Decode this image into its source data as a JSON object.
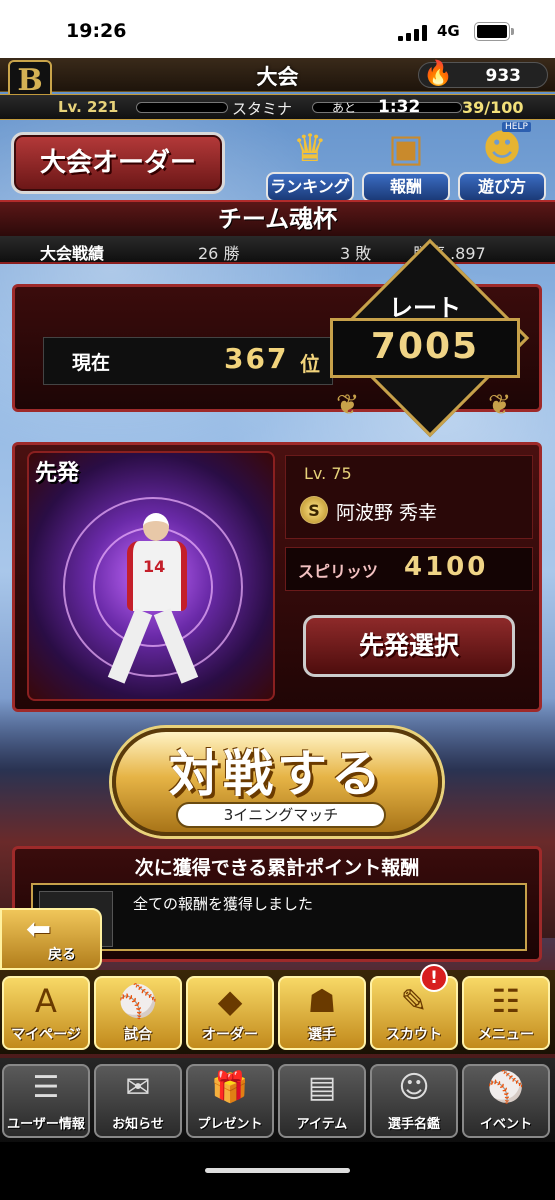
{
  "status_bar": {
    "time": "19:26",
    "network": "4G"
  },
  "header": {
    "logo": "B",
    "title": "大会",
    "coins": "933"
  },
  "level_bar": {
    "level": "Lv. 221",
    "stamina_label": "スタミナ",
    "remaining_label": "あと",
    "remaining_time": "1:32",
    "stamina": "39/100"
  },
  "top_buttons": {
    "order": "大会オーダー",
    "ranking": "ランキング",
    "rewards": "報酬",
    "how_to_play": "遊び方",
    "help": "HELP"
  },
  "tournament": {
    "name": "チーム魂杯",
    "record_label": "大会戦績",
    "wins": "26 勝",
    "losses": "3 敗",
    "win_rate": "勝率 .897"
  },
  "ranking": {
    "current_label": "現在",
    "position": "367",
    "position_suffix": "位",
    "rate_label": "レート",
    "rate_value": "7005"
  },
  "starter": {
    "label": "先発",
    "level": "Lv. 75",
    "rank_mark": "S",
    "name": "阿波野 秀幸",
    "spirits_label": "スピリッツ",
    "spirits_value": "4100",
    "jersey_number": "14",
    "select_button": "先発選択"
  },
  "battle": {
    "button": "対戦する",
    "subtitle": "3イニングマッチ"
  },
  "reward": {
    "title": "次に獲得できる累計ポイント報酬",
    "message": "全ての報酬を獲得しました",
    "back": "戻る"
  },
  "nav_primary": [
    {
      "label": "マイページ",
      "icon": "A"
    },
    {
      "label": "試合",
      "icon": "⚾"
    },
    {
      "label": "オーダー",
      "icon": "◆"
    },
    {
      "label": "選手",
      "icon": "☗"
    },
    {
      "label": "スカウト",
      "icon": "✎"
    },
    {
      "label": "メニュー",
      "icon": "☷"
    }
  ],
  "scout_badge": "!",
  "nav_secondary": [
    {
      "label": "ユーザー情報",
      "icon": "☰"
    },
    {
      "label": "お知らせ",
      "icon": "✉"
    },
    {
      "label": "プレゼント",
      "icon": "🎁"
    },
    {
      "label": "アイテム",
      "icon": "▤"
    },
    {
      "label": "選手名鑑",
      "icon": "☺"
    },
    {
      "label": "イベント",
      "icon": "⚾"
    }
  ]
}
